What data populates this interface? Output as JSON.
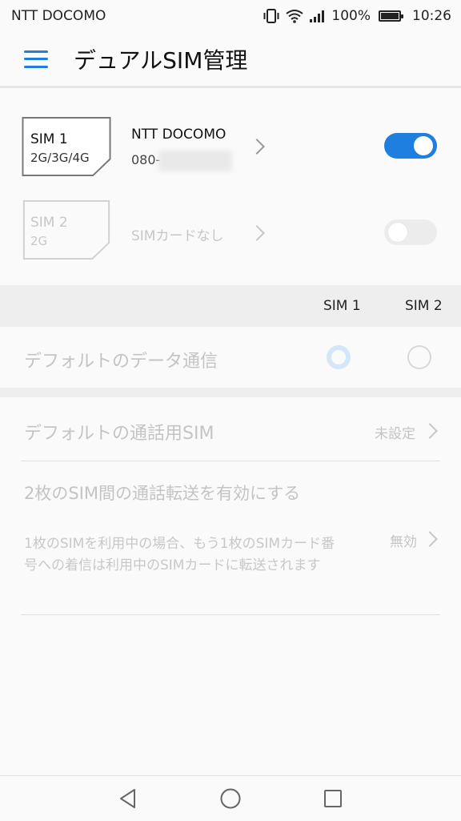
{
  "status_bar": {
    "carrier": "NTT DOCOMO",
    "battery": "100%",
    "time": "10:26"
  },
  "app_bar": {
    "title": "デュアルSIM管理"
  },
  "sims": [
    {
      "card_name": "SIM 1",
      "card_type": "2G/3G/4G",
      "carrier": "NTT DOCOMO",
      "number": "080-",
      "enabled": true
    },
    {
      "card_name": "SIM 2",
      "card_type": "2G",
      "status": "SIMカードなし",
      "enabled": false
    }
  ],
  "columns": {
    "sim1": "SIM 1",
    "sim2": "SIM 2"
  },
  "default_data": {
    "label": "デフォルトのデータ通信",
    "selected": "SIM 1"
  },
  "default_call": {
    "label": "デフォルトの通話用SIM",
    "value": "未設定"
  },
  "call_forwarding": {
    "title": "2枚のSIM間の通話転送を有効にする",
    "description": "1枚のSIMを利用中の場合、もう1枚のSIMカード番号への着信は利用中のSIMカードに転送されます",
    "value": "無効"
  },
  "colors": {
    "accent": "#1f7fe0"
  }
}
